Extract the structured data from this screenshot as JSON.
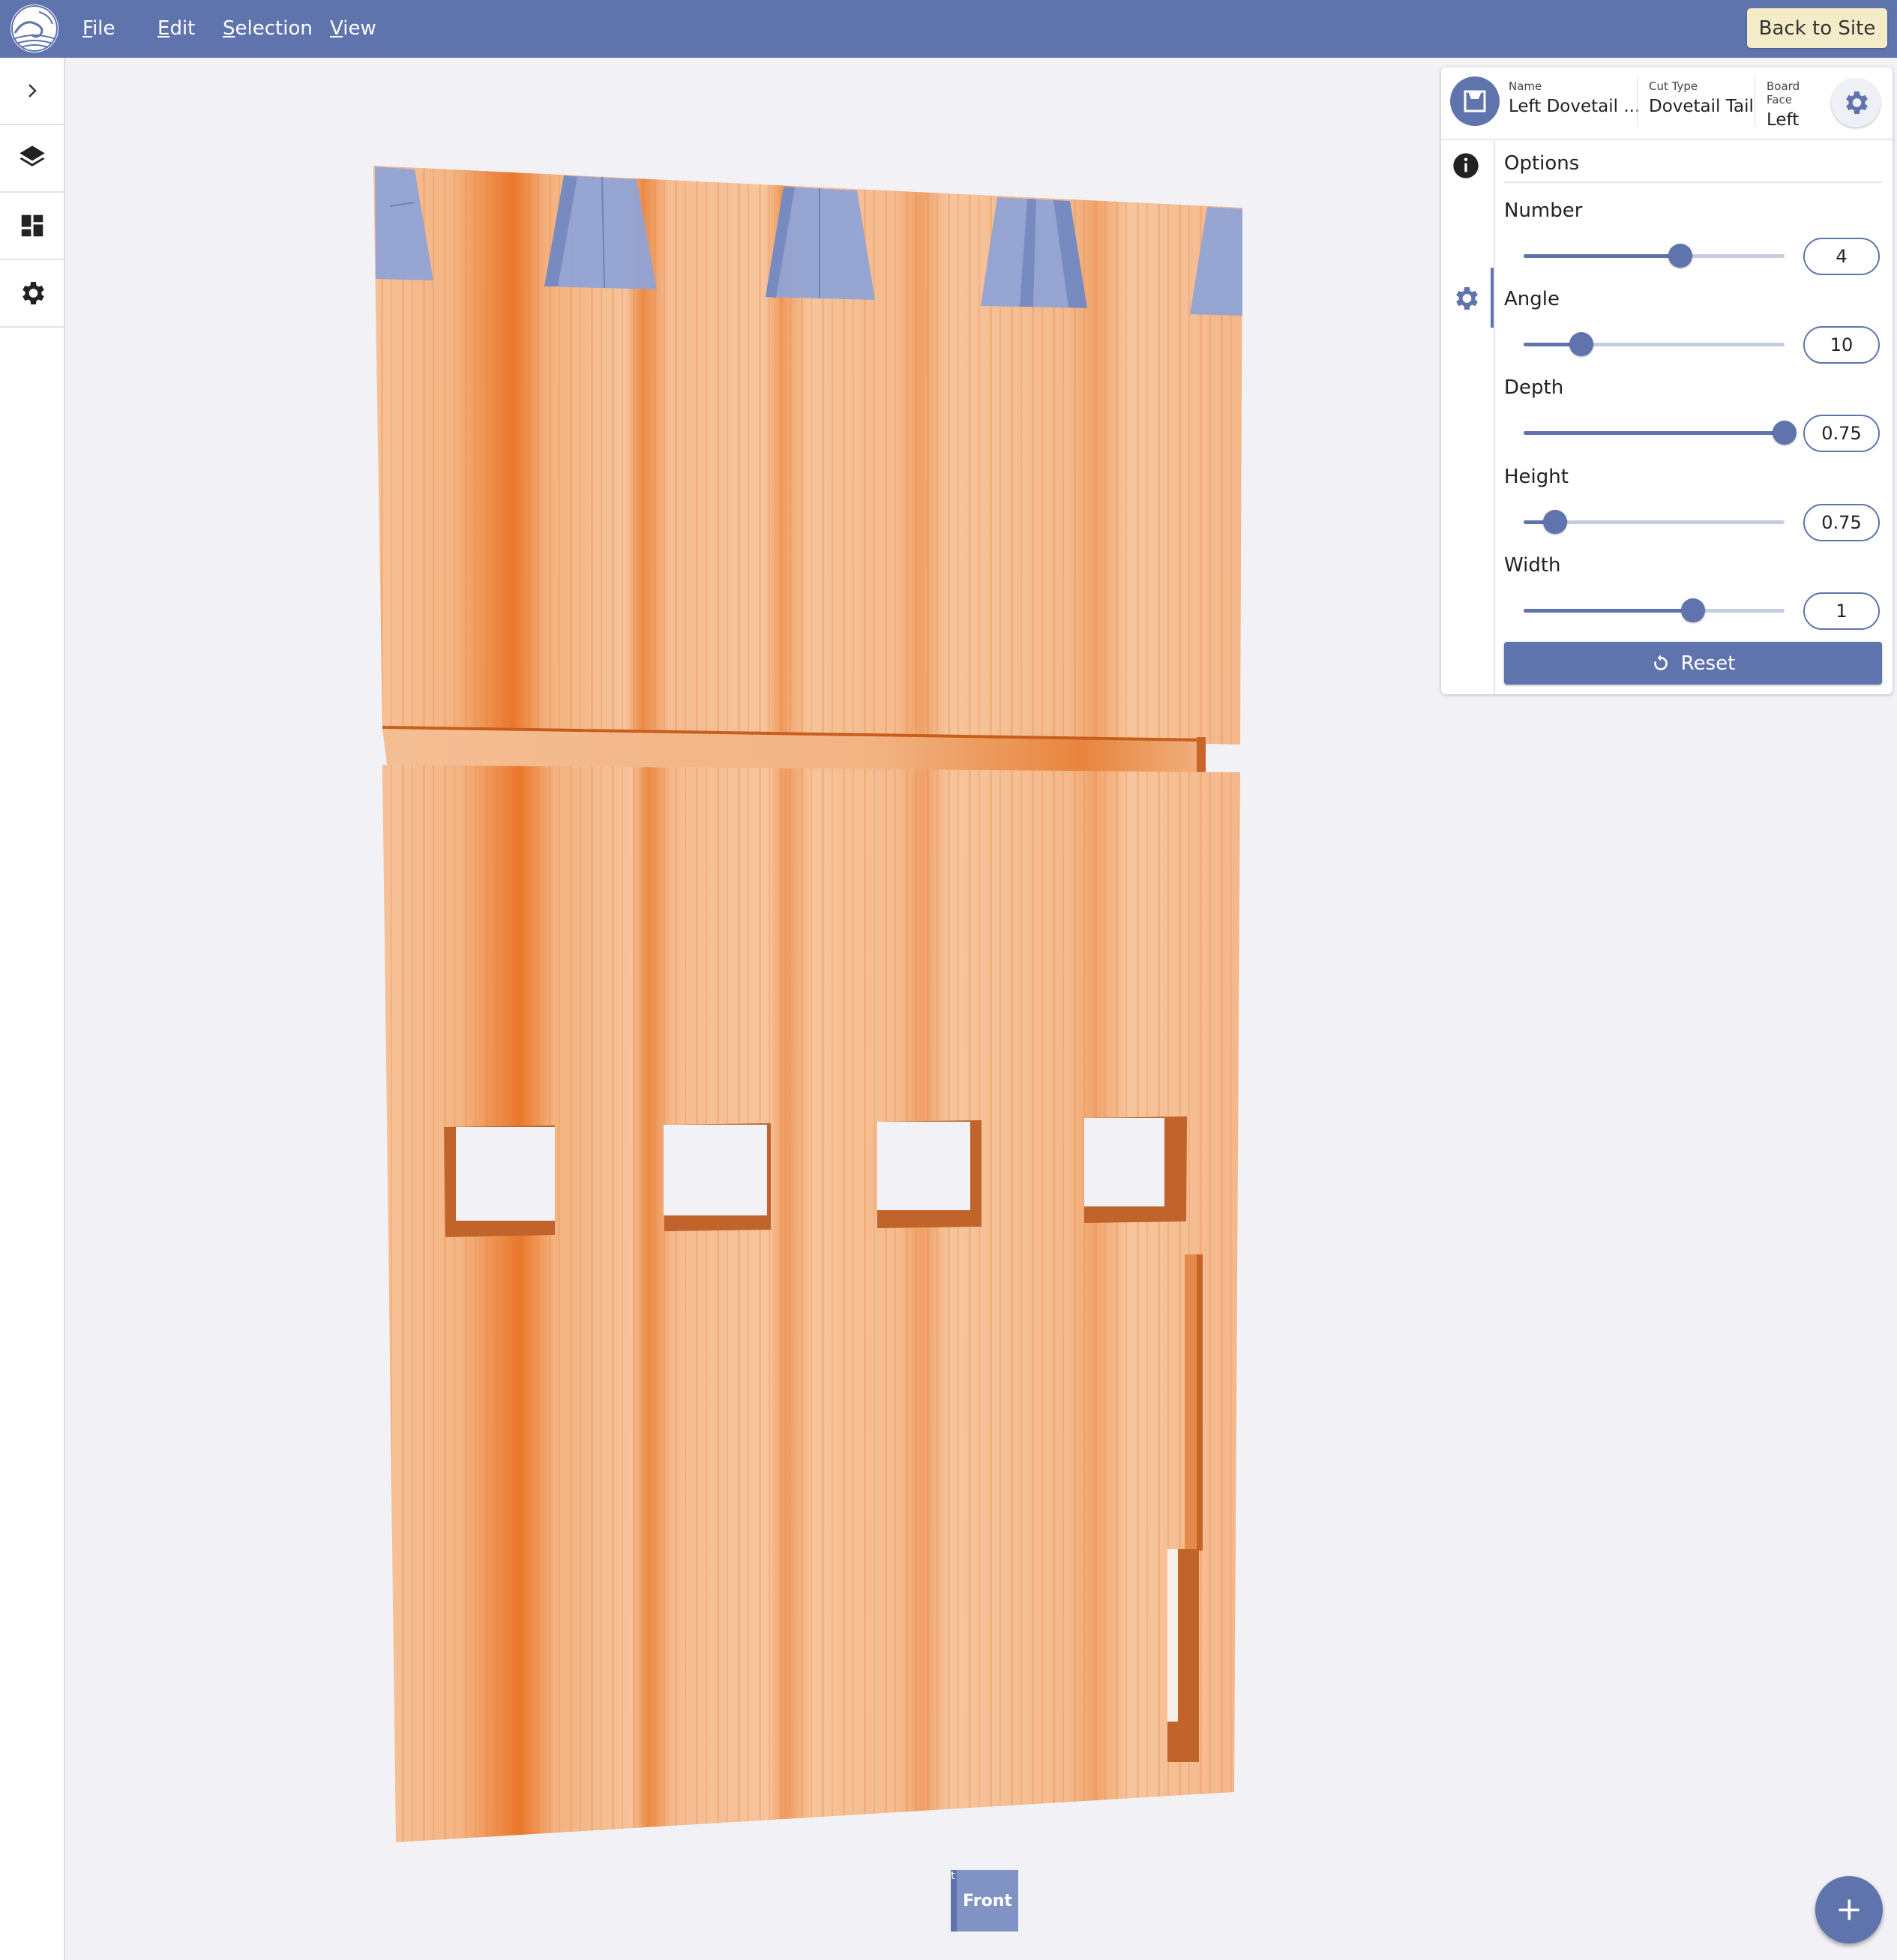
{
  "app": {
    "menu": [
      {
        "label": "File"
      },
      {
        "label": "Edit"
      },
      {
        "label": "Selection"
      },
      {
        "label": "View"
      }
    ],
    "back_button": "Back to Site"
  },
  "sidebar": {
    "items": [
      {
        "icon": "chevron-right-icon"
      },
      {
        "icon": "layers-icon"
      },
      {
        "icon": "dashboard-icon"
      },
      {
        "icon": "gear-icon"
      }
    ]
  },
  "properties": {
    "name_label": "Name",
    "name_value": "Left Dovetail ...",
    "cut_type_label": "Cut Type",
    "cut_type_value": "Dovetail Tail",
    "board_face_label": "Board Face",
    "board_face_value": "Left",
    "options_title": "Options",
    "options": [
      {
        "label": "Number",
        "value": "4",
        "level": 0.6
      },
      {
        "label": "Angle",
        "value": "10",
        "level": 0.22
      },
      {
        "label": "Depth",
        "value": "0.75",
        "level": 1.0
      },
      {
        "label": "Height",
        "value": "0.75",
        "level": 0.12
      },
      {
        "label": "Width",
        "value": "1",
        "level": 0.65
      }
    ],
    "reset_label": "Reset"
  },
  "viewcube": {
    "front_label": "Front",
    "side_label": "t"
  },
  "colors": {
    "accent": "#5f74ad",
    "back_button_bg": "#f4ecc9",
    "wood_light": "#f3b88a",
    "wood_dark": "#e8701f",
    "dovetail_tint": "#8ea3d8"
  }
}
